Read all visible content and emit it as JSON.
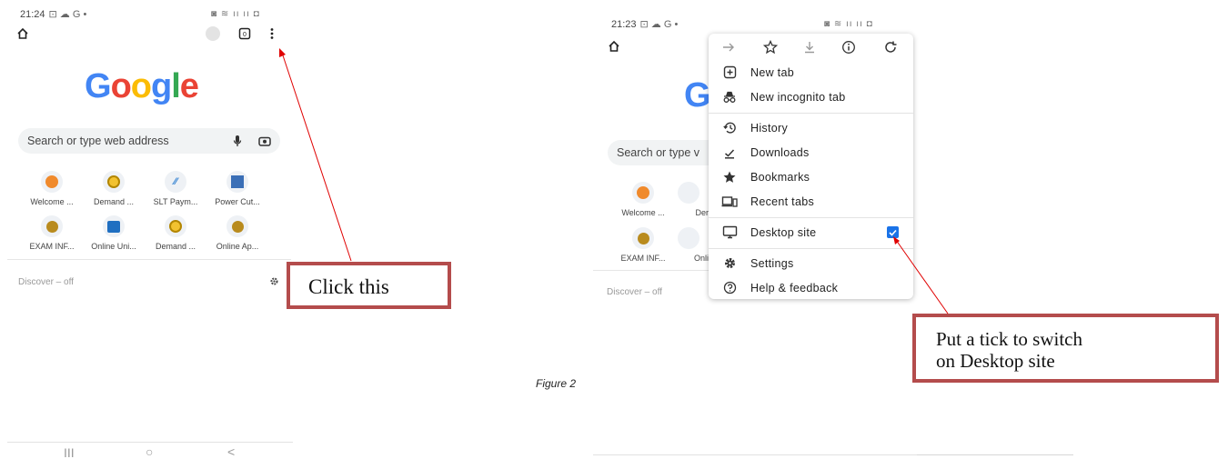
{
  "left_phone": {
    "status_time": "21:24",
    "status_glyphs": "⊡ ☁ G •",
    "status_right": "◙ ≋ ıı ıı ◘",
    "logo": {
      "letters": [
        "G",
        "o",
        "o",
        "g",
        "l",
        "e"
      ],
      "colors": [
        "#4285F4",
        "#EA4335",
        "#FBBC05",
        "#4285F4",
        "#34A853",
        "#EA4335"
      ]
    },
    "search_placeholder": "Search or type web address",
    "shortcuts_row1": [
      "Welcome ...",
      "Demand ...",
      "SLT Paym...",
      "Power Cut..."
    ],
    "shortcuts_row2": [
      "EXAM INF...",
      "Online Uni...",
      "Demand ...",
      "Online Ap..."
    ],
    "discover": "Discover – off",
    "nav": {
      "recents": "III",
      "home": "○",
      "back": "<"
    }
  },
  "callout_left": "Click this",
  "right_phone": {
    "status_time": "21:23",
    "status_glyphs": "⊡ ☁ G •",
    "status_right": "◙ ≋ ıı ıı ◘",
    "logo_partial": "G",
    "search_partial": "Search or type v",
    "shortcuts_row1": [
      "Welcome ...",
      "Der"
    ],
    "shortcuts_row2": [
      "EXAM INF...",
      "Onli"
    ],
    "discover": "Discover – off"
  },
  "menu": {
    "items": [
      {
        "label": "New tab",
        "icon": "plus-box-icon"
      },
      {
        "label": "New incognito tab",
        "icon": "incognito-icon"
      },
      {
        "label": "History",
        "icon": "history-icon"
      },
      {
        "label": "Downloads",
        "icon": "download-icon"
      },
      {
        "label": "Bookmarks",
        "icon": "star-filled-icon"
      },
      {
        "label": "Recent tabs",
        "icon": "devices-icon"
      },
      {
        "label": "Desktop site",
        "icon": "monitor-icon",
        "checked": true
      },
      {
        "label": "Settings",
        "icon": "gear-icon"
      },
      {
        "label": "Help & feedback",
        "icon": "help-icon"
      }
    ]
  },
  "callout_right": {
    "line1": "Put a tick to switch",
    "line2": "on Desktop site"
  },
  "caption": "Figure 2",
  "colors": {
    "annotation_border": "#b44c4c",
    "arrow": "#e00000",
    "checkbox": "#1a73e8"
  }
}
